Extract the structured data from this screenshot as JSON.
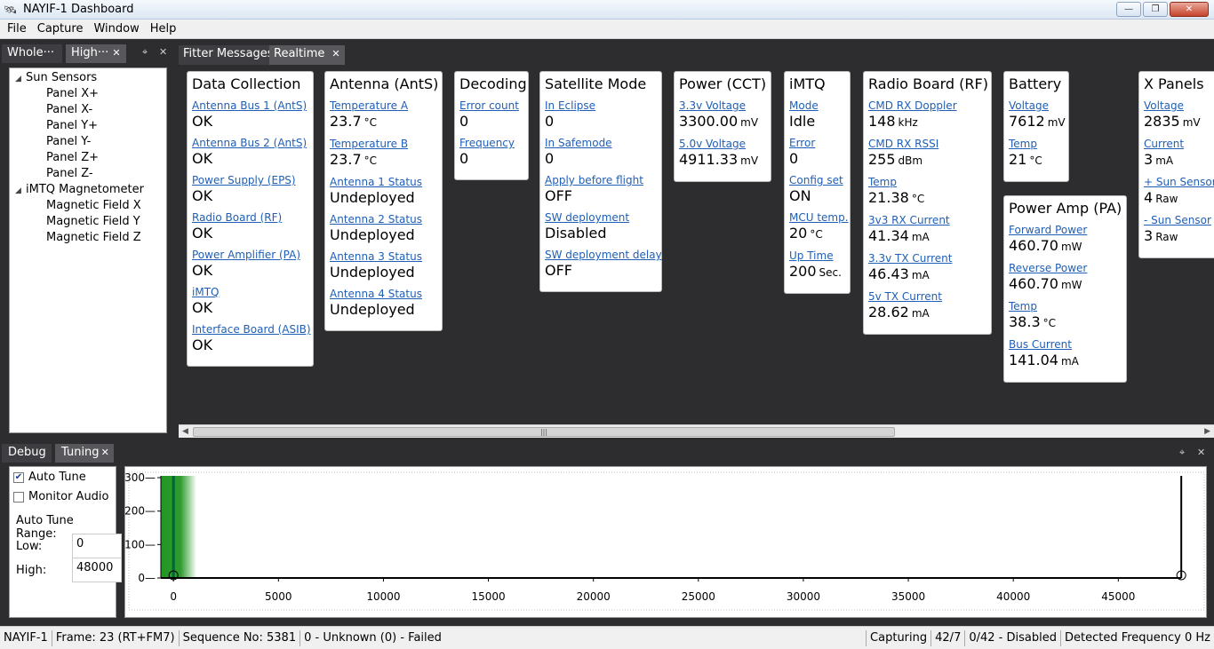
{
  "window": {
    "title": "NAYIF-1 Dashboard"
  },
  "menu": [
    "File",
    "Capture",
    "Window",
    "Help"
  ],
  "left_tabs": [
    "Whole···",
    "High···"
  ],
  "tree": [
    {
      "label": "Sun Sensors",
      "children": [
        "Panel X+",
        "Panel X-",
        "Panel Y+",
        "Panel Y-",
        "Panel Z+",
        "Panel Z-"
      ]
    },
    {
      "label": "iMTQ Magnetometer",
      "children": [
        "Magnetic Field X",
        "Magnetic Field Y",
        "Magnetic Field Z"
      ]
    }
  ],
  "doc_tabs": [
    "Fitter Messages",
    "Realtime"
  ],
  "cards": [
    {
      "title": "Data Collection",
      "fields": [
        {
          "label": "Antenna Bus 1 (AntS)",
          "value": "OK",
          "unit": ""
        },
        {
          "label": "Antenna Bus 2 (AntS)",
          "value": "OK",
          "unit": ""
        },
        {
          "label": "Power Supply (EPS)",
          "value": "OK",
          "unit": ""
        },
        {
          "label": "Radio Board (RF)",
          "value": "OK",
          "unit": ""
        },
        {
          "label": "Power Amplifier (PA)",
          "value": "OK",
          "unit": ""
        },
        {
          "label": "iMTQ",
          "value": "OK",
          "unit": ""
        },
        {
          "label": "Interface Board (ASIB)",
          "value": "OK",
          "unit": ""
        }
      ]
    },
    {
      "title": "Antenna (AntS)",
      "fields": [
        {
          "label": "Temperature A",
          "value": "23.7",
          "unit": "°C"
        },
        {
          "label": "Temperature B",
          "value": "23.7",
          "unit": "°C"
        },
        {
          "label": "Antenna 1 Status",
          "value": "Undeployed",
          "unit": ""
        },
        {
          "label": "Antenna 2 Status",
          "value": "Undeployed",
          "unit": ""
        },
        {
          "label": "Antenna 3 Status",
          "value": "Undeployed",
          "unit": ""
        },
        {
          "label": "Antenna 4 Status",
          "value": "Undeployed",
          "unit": ""
        }
      ]
    },
    {
      "title": "Decoding",
      "fields": [
        {
          "label": "Error count",
          "value": "0",
          "unit": ""
        },
        {
          "label": "Frequency",
          "value": "0",
          "unit": ""
        }
      ]
    },
    {
      "title": "Satellite Mode",
      "fields": [
        {
          "label": "In Eclipse",
          "value": "0",
          "unit": ""
        },
        {
          "label": "In Safemode",
          "value": "0",
          "unit": ""
        },
        {
          "label": "Apply before flight",
          "value": "OFF",
          "unit": ""
        },
        {
          "label": "SW deployment",
          "value": "Disabled",
          "unit": ""
        },
        {
          "label": "SW deployment delay",
          "value": "OFF",
          "unit": ""
        }
      ]
    },
    {
      "title": "Power (CCT)",
      "fields": [
        {
          "label": "3.3v Voltage",
          "value": "3300.00",
          "unit": "mV"
        },
        {
          "label": "5.0v Voltage",
          "value": "4911.33",
          "unit": "mV"
        }
      ]
    },
    {
      "title": "iMTQ",
      "fields": [
        {
          "label": "Mode",
          "value": "Idle",
          "unit": ""
        },
        {
          "label": "Error",
          "value": "0",
          "unit": ""
        },
        {
          "label": "Config set",
          "value": "ON",
          "unit": ""
        },
        {
          "label": "MCU temp.",
          "value": "20",
          "unit": "°C"
        },
        {
          "label": "Up Time",
          "value": "200",
          "unit": "Sec."
        }
      ]
    },
    {
      "title": "Radio Board (RF)",
      "fields": [
        {
          "label": "CMD RX Doppler",
          "value": "148",
          "unit": "kHz"
        },
        {
          "label": "CMD RX RSSI",
          "value": "255",
          "unit": "dBm"
        },
        {
          "label": "Temp",
          "value": "21.38",
          "unit": "°C"
        },
        {
          "label": "3v3 RX Current",
          "value": "41.34",
          "unit": "mA"
        },
        {
          "label": "3.3v TX Current",
          "value": "46.43",
          "unit": "mA"
        },
        {
          "label": "5v TX Current",
          "value": "28.62",
          "unit": "mA"
        }
      ]
    },
    {
      "title": "Battery",
      "fields": [
        {
          "label": "Voltage",
          "value": "7612",
          "unit": "mV"
        },
        {
          "label": "Temp",
          "value": "21",
          "unit": "°C"
        }
      ]
    },
    {
      "title": "Power Amp (PA)",
      "fields": [
        {
          "label": "Forward Power",
          "value": "460.70",
          "unit": "mW"
        },
        {
          "label": "Reverse Power",
          "value": "460.70",
          "unit": "mW"
        },
        {
          "label": "Temp",
          "value": "38.3",
          "unit": "°C"
        },
        {
          "label": "Bus Current",
          "value": "141.04",
          "unit": "mA"
        }
      ]
    },
    {
      "title": "X Panels",
      "fields": [
        {
          "label": "Voltage",
          "value": "2835",
          "unit": "mV"
        },
        {
          "label": "Current",
          "value": "3",
          "unit": "mA"
        },
        {
          "label": "+ Sun Sensor",
          "value": "4",
          "unit": "Raw"
        },
        {
          "label": "- Sun Sensor",
          "value": "3",
          "unit": "Raw"
        }
      ]
    }
  ],
  "bottom_tabs": [
    "Debug",
    "Tuning"
  ],
  "tuning": {
    "auto_tune": "Auto Tune",
    "auto_tune_checked": true,
    "monitor_audio": "Monitor Audio",
    "monitor_audio_checked": false,
    "range_label": "Auto Tune Range:",
    "low_label": "Low:",
    "low_value": "0",
    "high_label": "High:",
    "high_value": "48000"
  },
  "chart_data": {
    "type": "line",
    "x_ticks": [
      0,
      5000,
      10000,
      15000,
      20000,
      25000,
      30000,
      35000,
      40000,
      45000
    ],
    "y_ticks": [
      0,
      100,
      200,
      300
    ],
    "xlim": [
      -600,
      48500
    ],
    "ylim": [
      0,
      300
    ],
    "markers": [
      0,
      48000
    ],
    "signal_peak_x": 0,
    "grid": false,
    "colors": {
      "signal": "#0a8a0a"
    }
  },
  "status": {
    "callsign": "NAYIF-1",
    "frame": "Frame:  23 (RT+FM7)",
    "sequence": "Sequence No:  5381",
    "result": "0 - Unknown (0) - Failed",
    "capture": "Capturing",
    "ratio": "42/7",
    "disabled": "0/42 - Disabled",
    "detected": "Detected Frequency  0 Hz"
  }
}
